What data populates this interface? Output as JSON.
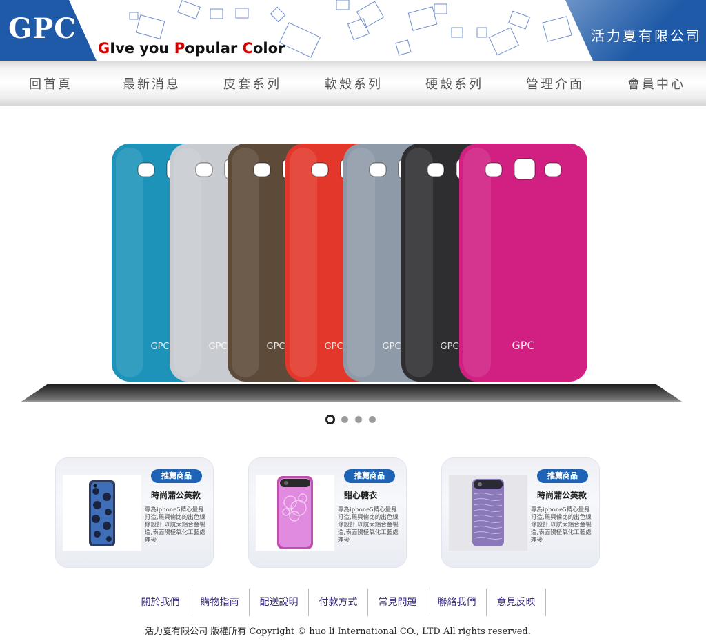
{
  "header": {
    "logo": "GPC",
    "tagline": [
      "G",
      "Ive you ",
      "P",
      "opular ",
      "C",
      "olor"
    ],
    "company_name": "活力夏有限公司",
    "brand_color": "#1f5aa8"
  },
  "nav": {
    "items": [
      "回首頁",
      "最新消息",
      "皮套系列",
      "軟殼系列",
      "硬殼系列",
      "管理介面",
      "會員中心"
    ]
  },
  "slider": {
    "case_colors": [
      "#1d93b9",
      "#c8cbd0",
      "#5d4a38",
      "#e2372a",
      "#8f9aa8",
      "#2e2e30",
      "#d11f82"
    ],
    "case_logo": "GPC",
    "active_slide": 1,
    "slide_count": 4
  },
  "products": [
    {
      "badge": "推薦商品",
      "title": "時尚蒲公英款",
      "desc": "專為iphone5精心量身打造,無與倫比的出色線條設計,以航太鋁合金製造,表面陽極氧化工藝處理後"
    },
    {
      "badge": "推薦商品",
      "title": "甜心糖衣",
      "desc": "專為iphone5精心量身打造,無與倫比的出色線條設計,以航太鋁合金製造,表面陽極氧化工藝處理後"
    },
    {
      "badge": "推薦商品",
      "title": "時尚蒲公英款",
      "desc": "專為iphone5精心量身打造,無與倫比的出色線條設計,以航太鋁合金製造,表面陽極氧化工藝處理後"
    }
  ],
  "footer": {
    "links": [
      "關於我們",
      "購物指南",
      "配送說明",
      "付款方式",
      "常見問題",
      "聯絡我們",
      "意見反映"
    ],
    "copyright": "活力夏有限公司 版權所有 Copyright © huo li International CO., LTD All rights reserved."
  }
}
